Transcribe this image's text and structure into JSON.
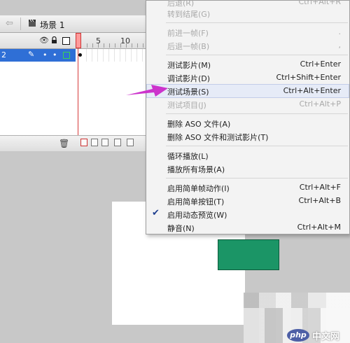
{
  "scene_bar": {
    "back_arrow": "⇦",
    "scene_label": "场景 1"
  },
  "timeline": {
    "header_icons": {
      "eye": "eye-icon",
      "lock": "lock-icon"
    },
    "ruler": [
      "5",
      "10"
    ],
    "layer": {
      "name": "2"
    }
  },
  "menu": {
    "items": [
      {
        "label": "后退(R)",
        "shortcut": "Ctrl+Alt+R",
        "disabled": true
      },
      {
        "label": "转到结尾(G)",
        "shortcut": "",
        "disabled": true
      },
      {
        "label": "前进一帧(F)",
        "shortcut": ".",
        "disabled": true
      },
      {
        "label": "后退一帧(B)",
        "shortcut": ",",
        "disabled": true
      },
      {
        "label": "测试影片(M)",
        "shortcut": "Ctrl+Enter",
        "disabled": false
      },
      {
        "label": "调试影片(D)",
        "shortcut": "Ctrl+Shift+Enter",
        "disabled": false
      },
      {
        "label": "测试场景(S)",
        "shortcut": "Ctrl+Alt+Enter",
        "disabled": false,
        "highlighted": true
      },
      {
        "label": "测试项目(J)",
        "shortcut": "Ctrl+Alt+P",
        "disabled": true
      },
      {
        "label": "删除 ASO 文件(A)",
        "shortcut": "",
        "disabled": false
      },
      {
        "label": "删除 ASO 文件和测试影片(T)",
        "shortcut": "",
        "disabled": false
      },
      {
        "label": "循环播放(L)",
        "shortcut": "",
        "disabled": false
      },
      {
        "label": "播放所有场景(A)",
        "shortcut": "",
        "disabled": false
      },
      {
        "label": "启用简单帧动作(I)",
        "shortcut": "Ctrl+Alt+F",
        "disabled": false
      },
      {
        "label": "启用简单按钮(T)",
        "shortcut": "Ctrl+Alt+B",
        "disabled": false
      },
      {
        "label": "启用动态预览(W)",
        "shortcut": "",
        "disabled": false,
        "checked": true
      },
      {
        "label": "静音(N)",
        "shortcut": "Ctrl+Alt+M",
        "disabled": false
      }
    ]
  },
  "watermark": {
    "logo": "php",
    "text": "中文网"
  },
  "colors": {
    "accent": "#2f6fd6",
    "arrow": "#cc33cc",
    "stage_rect": "#1b9566",
    "playhead": "#d63a3a"
  }
}
